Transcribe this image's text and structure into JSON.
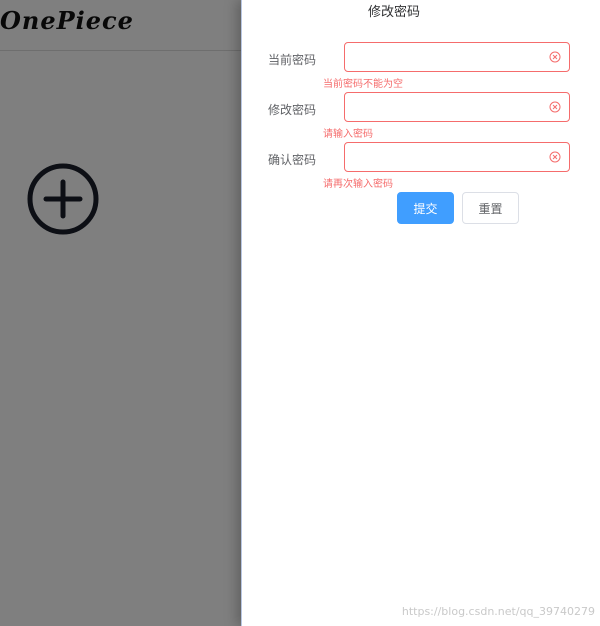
{
  "background": {
    "logo_text": "OnePiece",
    "add_icon": "plus-circle-icon"
  },
  "drawer": {
    "title": "修改密码",
    "fields": [
      {
        "label": "当前密码",
        "value": "",
        "placeholder": "",
        "error": "当前密码不能为空"
      },
      {
        "label": "修改密码",
        "value": "",
        "placeholder": "",
        "error": "请输入密码"
      },
      {
        "label": "确认密码",
        "value": "",
        "placeholder": "",
        "error": "请再次输入密码"
      }
    ],
    "submit_label": "提交",
    "reset_label": "重置"
  },
  "watermark": "https://blog.csdn.net/qq_39740279",
  "colors": {
    "primary": "#409eff",
    "error": "#f56c6c",
    "overlay": "rgba(0,0,0,0.5)"
  }
}
